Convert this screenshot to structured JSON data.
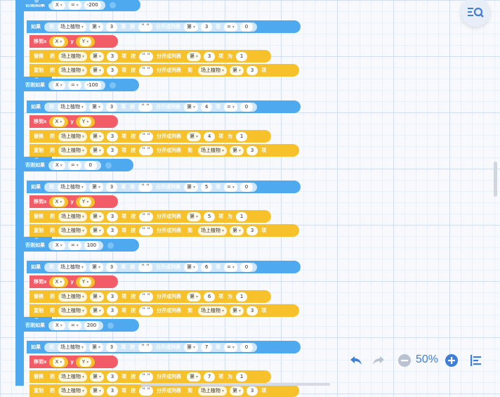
{
  "labels": {
    "else_if": "否则如果",
    "if": "如果",
    "move_to": "移到x",
    "y": "y",
    "replace": "替换",
    "copy": "复制",
    "take": "把",
    "nth": "第",
    "item": "项",
    "by": "按",
    "split": "分开成列表",
    "to": "到",
    "as": "为",
    "plant_var": "场上植物",
    "var_x": "X",
    "var_y": "Y",
    "eq": "=",
    "quote": "\" \""
  },
  "blocks": [
    {
      "else_if_value": "-200",
      "split_index": "3",
      "if_compare_value": "0",
      "replace_index": "3",
      "replace_value": "1",
      "copy_index": "3",
      "item_index": "3"
    },
    {
      "else_if_value": "-100",
      "split_index": "4",
      "if_compare_value": "0",
      "replace_index": "4",
      "replace_value": "1",
      "copy_index": "3",
      "item_index": "3"
    },
    {
      "else_if_value": "0",
      "split_index": "5",
      "if_compare_value": "0",
      "replace_index": "5",
      "replace_value": "1",
      "copy_index": "3",
      "item_index": "3"
    },
    {
      "else_if_value": "100",
      "split_index": "6",
      "if_compare_value": "0",
      "replace_index": "6",
      "replace_value": "1",
      "copy_index": "3",
      "item_index": "3"
    },
    {
      "else_if_value": "200",
      "split_index": "7",
      "if_compare_value": "0",
      "replace_index": "7",
      "replace_value": "1",
      "copy_index": "3",
      "item_index": "3"
    }
  ],
  "controls": {
    "zoom": "50%",
    "undo_icon": "undo-icon",
    "redo_icon": "redo-icon",
    "zoom_out_icon": "zoom-out-icon",
    "zoom_in_icon": "zoom-in-icon",
    "align_icon": "align-left-icon",
    "search_icon": "search-blocks-icon"
  },
  "colors": {
    "control_block": "#4fa9ee",
    "motion_block": "#f25c67",
    "list_block": "#f6c12a",
    "accent": "#3f7fd7"
  }
}
